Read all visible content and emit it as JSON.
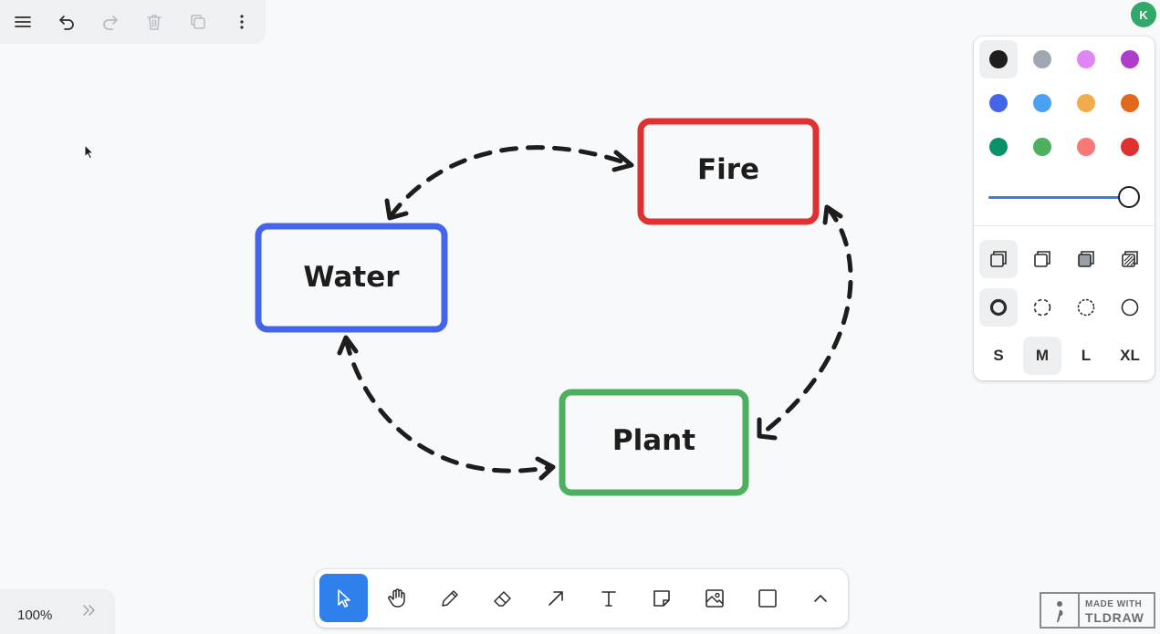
{
  "menu": {
    "items": [
      {
        "name": "menu-icon",
        "enabled": true
      },
      {
        "name": "undo-icon",
        "enabled": true
      },
      {
        "name": "redo-icon",
        "enabled": false
      },
      {
        "name": "trash-icon",
        "enabled": false
      },
      {
        "name": "duplicate-icon",
        "enabled": false
      },
      {
        "name": "more-vertical-icon",
        "enabled": true
      }
    ]
  },
  "user": {
    "avatar_initial": "K",
    "avatar_color": "#2fa86a"
  },
  "style_panel": {
    "colors": [
      {
        "name": "black",
        "hex": "#1d1d1d",
        "selected": true
      },
      {
        "name": "grey",
        "hex": "#9fa8b2",
        "selected": false
      },
      {
        "name": "light-violet",
        "hex": "#e085f4",
        "selected": false
      },
      {
        "name": "violet",
        "hex": "#ae3ec9",
        "selected": false
      },
      {
        "name": "blue",
        "hex": "#4465e9",
        "selected": false
      },
      {
        "name": "light-blue",
        "hex": "#4ba1f1",
        "selected": false
      },
      {
        "name": "yellow",
        "hex": "#f1ac4b",
        "selected": false
      },
      {
        "name": "orange",
        "hex": "#e16919",
        "selected": false
      },
      {
        "name": "green",
        "hex": "#099268",
        "selected": false
      },
      {
        "name": "light-green",
        "hex": "#4cb05e",
        "selected": false
      },
      {
        "name": "light-red",
        "hex": "#f87777",
        "selected": false
      },
      {
        "name": "red",
        "hex": "#e03131",
        "selected": false
      }
    ],
    "opacity": 1.0,
    "fill_options": [
      "fill-none-icon",
      "fill-semi-icon",
      "fill-solid-icon",
      "fill-pattern-icon"
    ],
    "fill_selected": 0,
    "dash_options": [
      "dash-draw-icon",
      "dash-dashed-icon",
      "dash-dotted-icon",
      "dash-solid-icon"
    ],
    "dash_selected": 0,
    "sizes": [
      "S",
      "M",
      "L",
      "XL"
    ],
    "size_selected": "M"
  },
  "diagram": {
    "nodes": [
      {
        "id": "fire",
        "label": "Fire",
        "color": "#e03131"
      },
      {
        "id": "water",
        "label": "Water",
        "color": "#4465e9"
      },
      {
        "id": "plant",
        "label": "Plant",
        "color": "#4cb05e"
      }
    ],
    "edges": [
      {
        "from": "water",
        "to": "fire",
        "style": "dashed",
        "bidirectional": true
      },
      {
        "from": "fire",
        "to": "plant",
        "style": "dashed",
        "bidirectional": true
      },
      {
        "from": "plant",
        "to": "water",
        "style": "dashed",
        "bidirectional": true
      }
    ]
  },
  "toolbar": {
    "tools": [
      {
        "name": "select-tool",
        "icon": "cursor-icon",
        "selected": true
      },
      {
        "name": "hand-tool",
        "icon": "hand-icon",
        "selected": false
      },
      {
        "name": "draw-tool",
        "icon": "pencil-icon",
        "selected": false
      },
      {
        "name": "eraser-tool",
        "icon": "eraser-icon",
        "selected": false
      },
      {
        "name": "arrow-tool",
        "icon": "arrow-icon",
        "selected": false
      },
      {
        "name": "text-tool",
        "icon": "text-icon",
        "selected": false
      },
      {
        "name": "note-tool",
        "icon": "sticky-note-icon",
        "selected": false
      },
      {
        "name": "asset-tool",
        "icon": "image-icon",
        "selected": false
      },
      {
        "name": "rectangle-tool",
        "icon": "rectangle-icon",
        "selected": false
      },
      {
        "name": "more-tools",
        "icon": "chevron-up-icon",
        "selected": false
      }
    ]
  },
  "zoom": {
    "label": "100%"
  },
  "watermark": {
    "line1": "MADE WITH",
    "line2": "TLDRAW"
  }
}
